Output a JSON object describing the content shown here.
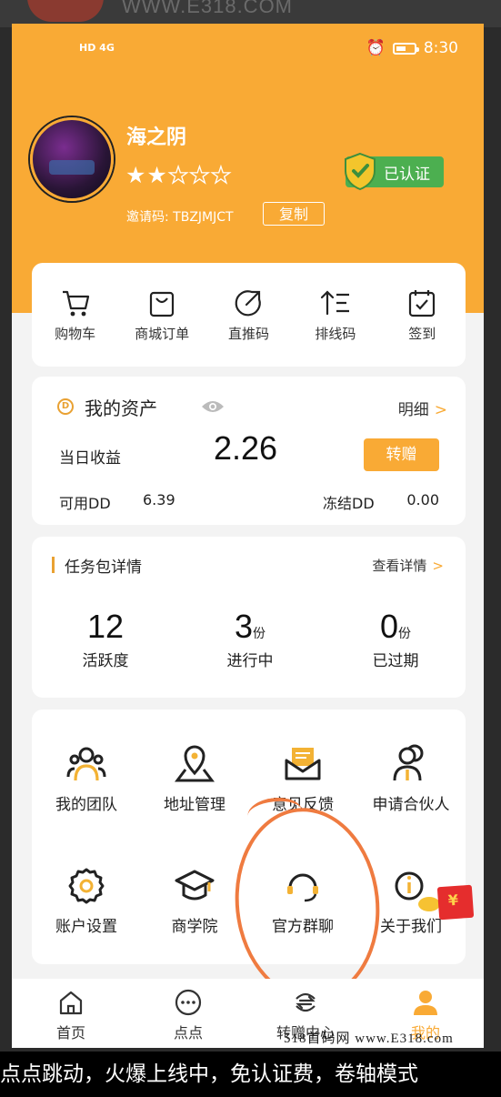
{
  "backdrop": {
    "watermark_top": "WWW.E318.COM"
  },
  "status_bar": {
    "left": "HD 4G",
    "time": "8:30"
  },
  "profile": {
    "name": "海之阴",
    "rating": 2,
    "rating_max": 5,
    "verified_label": "已认证",
    "invite_label": "邀请码: TBZJMJCT",
    "copy_label": "复制"
  },
  "quick_actions": [
    {
      "label": "购物车",
      "icon": "cart-icon"
    },
    {
      "label": "商城订单",
      "icon": "shopping-bag-icon"
    },
    {
      "label": "直推码",
      "icon": "arrow-up-right-circle-icon"
    },
    {
      "label": "排线码",
      "icon": "sort-list-icon"
    },
    {
      "label": "签到",
      "icon": "calendar-check-icon"
    }
  ],
  "assets": {
    "badge": "D",
    "title": "我的资产",
    "detail_label": "明细",
    "today_label": "当日收益",
    "today_value": "2.26",
    "transfer_label": "转赠",
    "available_label": "可用DD",
    "available_value": "6.39",
    "frozen_label": "冻结DD",
    "frozen_value": "0.00"
  },
  "tasks": {
    "title": "任务包详情",
    "more_label": "查看详情",
    "stats": [
      {
        "value": "12",
        "unit": "",
        "label": "活跃度"
      },
      {
        "value": "3",
        "unit": "份",
        "label": "进行中"
      },
      {
        "value": "0",
        "unit": "份",
        "label": "已过期"
      }
    ]
  },
  "services": [
    {
      "label": "我的团队",
      "icon": "team-icon"
    },
    {
      "label": "地址管理",
      "icon": "location-pin-icon"
    },
    {
      "label": "意见反馈",
      "icon": "mail-icon"
    },
    {
      "label": "申请合伙人",
      "icon": "partner-icon"
    },
    {
      "label": "账户设置",
      "icon": "settings-gear-icon"
    },
    {
      "label": "商学院",
      "icon": "graduation-cap-icon"
    },
    {
      "label": "官方群聊",
      "icon": "headset-icon"
    },
    {
      "label": "关于我们",
      "icon": "info-icon"
    }
  ],
  "tabbar": [
    {
      "label": "首页",
      "icon": "home-icon",
      "active": false
    },
    {
      "label": "点点",
      "icon": "dots-circle-icon",
      "active": false
    },
    {
      "label": "转赠中心",
      "icon": "exchange-icon",
      "active": false
    },
    {
      "label": "我的",
      "icon": "user-icon",
      "active": true
    }
  ],
  "watermark_bottom": "518首码网 www.E318.com",
  "caption": "点点跳动，火爆上线中，免认证费，卷轴模式",
  "colors": {
    "accent": "#f9aa35",
    "verified": "#4caf50",
    "annotation": "#ef7b40"
  }
}
